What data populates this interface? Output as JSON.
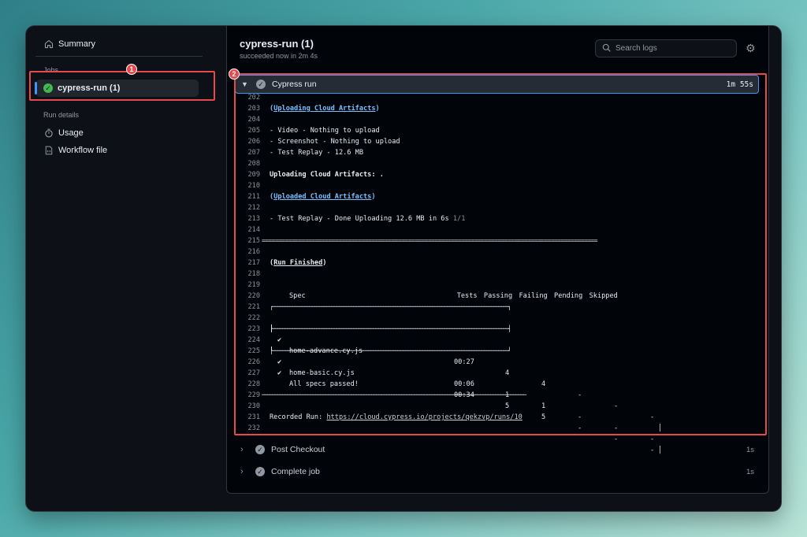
{
  "sidebar": {
    "summary_label": "Summary",
    "jobs_label": "Jobs",
    "job_active": "cypress-run (1)",
    "run_details_label": "Run details",
    "usage_label": "Usage",
    "workflow_label": "Workflow file"
  },
  "annotations": {
    "badge1": "1",
    "badge2": "2"
  },
  "header": {
    "title": "cypress-run (1)",
    "subtitle": "succeeded now in 2m 4s",
    "search_placeholder": "Search logs"
  },
  "steps": {
    "active": {
      "label": "Cypress run",
      "duration": "1m 55s"
    },
    "post_checkout": {
      "label": "Post Checkout",
      "duration": "1s"
    },
    "complete_job": {
      "label": "Complete job",
      "duration": "1s"
    }
  },
  "log": {
    "l202": "202",
    "l203": "203",
    "l204": "204",
    "l205": "205",
    "l206": "206",
    "l207": "207",
    "l208": "208",
    "l209": "209",
    "l210": "210",
    "l211": "211",
    "l212": "212",
    "l213": "213",
    "l214": "214",
    "l215": "215",
    "l216": "216",
    "l217": "217",
    "l218": "218",
    "l219": "219",
    "l220": "220",
    "l221": "221",
    "l222": "222",
    "l223": "223",
    "l224": "224",
    "l225": "225",
    "l226": "226",
    "l227": "227",
    "l228": "228",
    "l229": "229",
    "l230": "230",
    "l231": "231",
    "l232": "232",
    "uploading_title": "Uploading Cloud Artifacts",
    "video": "- Video - Nothing to upload",
    "screenshot": "- Screenshot - Nothing to upload",
    "replay": "- Test Replay - 12.6 MB",
    "uploading_progress": "Uploading Cloud Artifacts: .",
    "uploaded_title": "Uploaded Cloud Artifacts",
    "replay_done": "- Test Replay - Done Uploading 12.6 MB in 6s",
    "replay_count": "1/1",
    "separator": "=====================================================================================================",
    "run_finished": "Run Finished",
    "table_header": "Spec                                              Tests  Passing  Failing  Pending  Skipped",
    "table_top": "┌────────────────────────────────────────────────────────────────────────────────────────────────┐",
    "table_mid": "├────────────────────────────────────────────────────────────────────────────────────────────────┤",
    "table_bot": "└────────────────────────────────────────────────────────────────────────────────────────────────┘",
    "row1_spec": "home-advance.cy.js",
    "row1_time": "00:27",
    "row1_tests": "4",
    "row1_pass": "4",
    "row2_spec": "home-basic.cy.js",
    "row2_time": "00:06",
    "row2_tests": "1",
    "row2_pass": "1",
    "total_label": "All specs passed!",
    "total_time": "00:34",
    "total_tests": "5",
    "total_pass": "5",
    "dash": "-",
    "check": "✔",
    "bar": "│",
    "rule": "────────────────────────────────────────────────────────────────────────────────────────────────────────",
    "recorded_label": "Recorded Run:",
    "recorded_url": "https://cloud.cypress.io/projects/qekzvp/runs/10"
  }
}
